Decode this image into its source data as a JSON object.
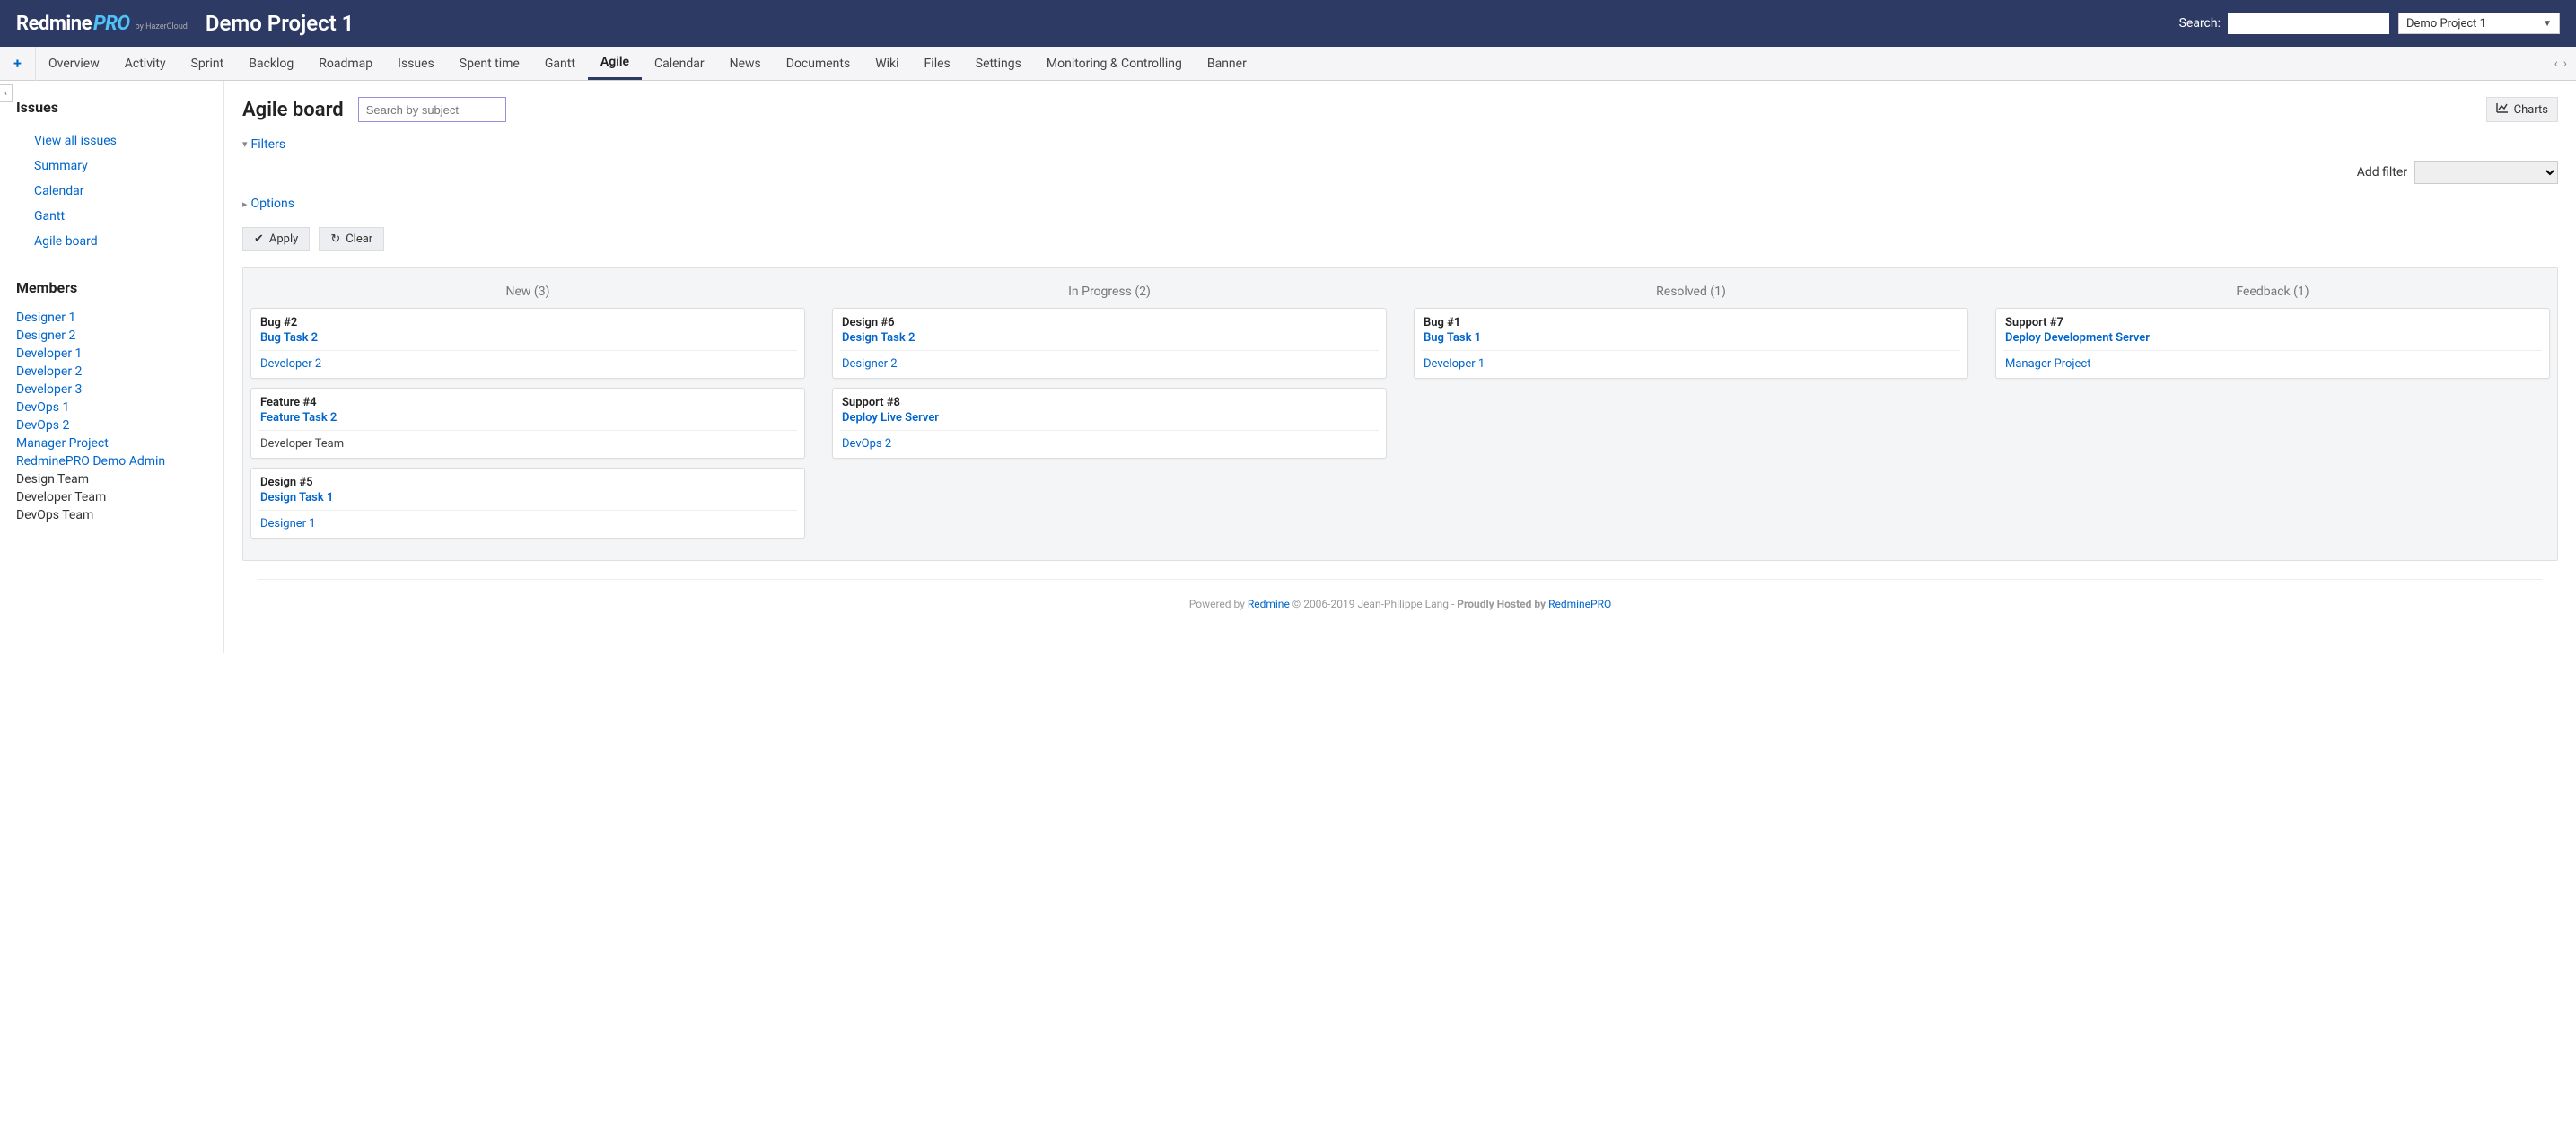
{
  "header": {
    "logo_main": "Redmine",
    "logo_pro": "PRO",
    "logo_sub": "by HazerCloud",
    "project_title": "Demo Project 1",
    "search_label": "Search:",
    "project_selector": "Demo Project 1"
  },
  "tabs": [
    {
      "label": "Overview",
      "active": false
    },
    {
      "label": "Activity",
      "active": false
    },
    {
      "label": "Sprint",
      "active": false
    },
    {
      "label": "Backlog",
      "active": false
    },
    {
      "label": "Roadmap",
      "active": false
    },
    {
      "label": "Issues",
      "active": false
    },
    {
      "label": "Spent time",
      "active": false
    },
    {
      "label": "Gantt",
      "active": false
    },
    {
      "label": "Agile",
      "active": true
    },
    {
      "label": "Calendar",
      "active": false
    },
    {
      "label": "News",
      "active": false
    },
    {
      "label": "Documents",
      "active": false
    },
    {
      "label": "Wiki",
      "active": false
    },
    {
      "label": "Files",
      "active": false
    },
    {
      "label": "Settings",
      "active": false
    },
    {
      "label": "Monitoring & Controlling",
      "active": false
    },
    {
      "label": "Banner",
      "active": false
    }
  ],
  "sidebar": {
    "issues_heading": "Issues",
    "issues_links": [
      "View all issues",
      "Summary",
      "Calendar",
      "Gantt",
      "Agile board"
    ],
    "members_heading": "Members",
    "members": [
      {
        "label": "Designer 1",
        "link": true
      },
      {
        "label": "Designer 2",
        "link": true
      },
      {
        "label": "Developer 1",
        "link": true
      },
      {
        "label": "Developer 2",
        "link": true
      },
      {
        "label": "Developer 3",
        "link": true
      },
      {
        "label": "DevOps 1",
        "link": true
      },
      {
        "label": "DevOps 2",
        "link": true
      },
      {
        "label": "Manager Project",
        "link": true
      },
      {
        "label": "RedminePRO Demo Admin",
        "link": true
      },
      {
        "label": "Design Team",
        "link": false
      },
      {
        "label": "Developer Team",
        "link": false
      },
      {
        "label": "DevOps Team",
        "link": false
      }
    ]
  },
  "main": {
    "title": "Agile board",
    "search_placeholder": "Search by subject",
    "charts_label": "Charts",
    "filters_label": "Filters",
    "add_filter_label": "Add filter",
    "options_label": "Options",
    "apply_label": "Apply",
    "clear_label": "Clear"
  },
  "board": {
    "columns": [
      {
        "title": "New (3)",
        "cards": [
          {
            "type": "Bug #2",
            "title": "Bug Task 2",
            "assignee": "Developer 2",
            "assignee_link": true
          },
          {
            "type": "Feature #4",
            "title": "Feature Task 2",
            "assignee": "Developer Team",
            "assignee_link": false
          },
          {
            "type": "Design #5",
            "title": "Design Task 1",
            "assignee": "Designer 1",
            "assignee_link": true
          }
        ]
      },
      {
        "title": "In Progress (2)",
        "cards": [
          {
            "type": "Design #6",
            "title": "Design Task 2",
            "assignee": "Designer 2",
            "assignee_link": true
          },
          {
            "type": "Support #8",
            "title": "Deploy Live Server",
            "assignee": "DevOps 2",
            "assignee_link": true
          }
        ]
      },
      {
        "title": "Resolved (1)",
        "cards": [
          {
            "type": "Bug #1",
            "title": "Bug Task 1",
            "assignee": "Developer 1",
            "assignee_link": true
          }
        ]
      },
      {
        "title": "Feedback (1)",
        "cards": [
          {
            "type": "Support #7",
            "title": "Deploy Development Server",
            "assignee": "Manager Project",
            "assignee_link": true
          }
        ]
      }
    ]
  },
  "footer": {
    "powered_by": "Powered by ",
    "redmine": "Redmine",
    "copyright": " © 2006-2019 Jean-Philippe Lang - ",
    "hosted_by": "Proudly Hosted by ",
    "redminepro": "RedminePRO"
  }
}
